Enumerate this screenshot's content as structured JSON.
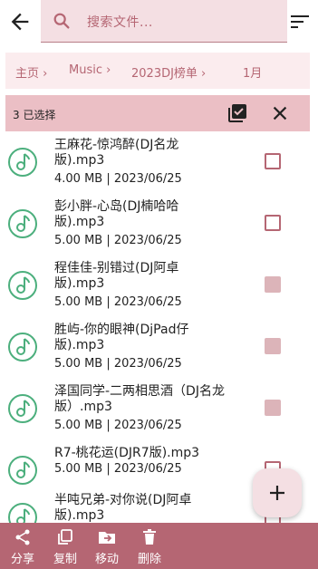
{
  "search": {
    "placeholder": "搜索文件..."
  },
  "breadcrumb": [
    "主页 ›",
    "Music ›",
    "2023DJ榜单 ›",
    "1月"
  ],
  "selection": {
    "count_label": "3 已选择"
  },
  "files": [
    {
      "name": "王麻花-惊鸿醉(DJ名龙版).mp3",
      "meta": "4.00 MB | 2023/06/25",
      "checked": false
    },
    {
      "name": "彭小胖-心岛(DJ楠哈哈版).mp3",
      "meta": "5.00 MB | 2023/06/25",
      "checked": false
    },
    {
      "name": "程佳佳-别错过(DJ阿卓版).mp3",
      "meta": "5.00 MB | 2023/06/25",
      "checked": true
    },
    {
      "name": "胜屿-你的眼神(DjPad仔版).mp3",
      "meta": "5.00 MB | 2023/06/25",
      "checked": true
    },
    {
      "name": "泽国同学-二两相思酒（DJ名龙版）.mp3",
      "meta": "5.00 MB | 2023/06/25",
      "checked": true
    },
    {
      "name": "R7-桃花运(DJR7版).mp3",
      "meta": "5.00 MB | 2023/06/25",
      "checked": false
    },
    {
      "name": "半吨兄弟-对你说(DJ阿卓版).mp3",
      "meta": "",
      "checked": false
    }
  ],
  "bottom_bar": [
    {
      "label": "分享",
      "icon": "share-icon"
    },
    {
      "label": "复制",
      "icon": "copy-icon"
    },
    {
      "label": "移动",
      "icon": "move-icon"
    },
    {
      "label": "删除",
      "icon": "delete-icon"
    }
  ],
  "colors": {
    "accent": "#b56673",
    "search_bg": "#f4dfe3",
    "breadcrumb_bg": "#fbecee",
    "selection_bar": "#ebbfc5",
    "checkbox_checked": "#dcb4b9",
    "music_icon": "#4caf7d"
  }
}
